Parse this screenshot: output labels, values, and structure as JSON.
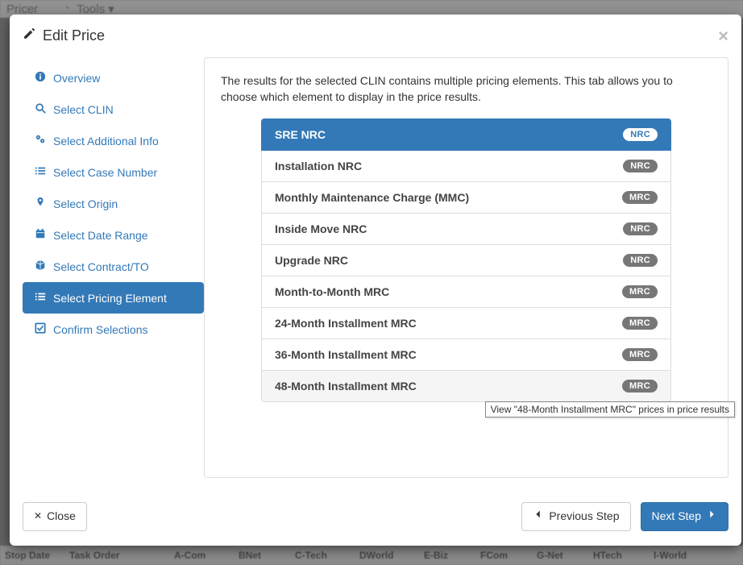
{
  "background": {
    "top_items": [
      "Pricer",
      "Tools"
    ],
    "table_headers": [
      "Stop Date",
      "Task Order",
      "A-Com",
      "BNet",
      "C-Tech",
      "DWorld",
      "E-Biz",
      "FCom",
      "G-Net",
      "HTech",
      "I-World"
    ]
  },
  "modal": {
    "title": "Edit Price",
    "close_aria": "Close"
  },
  "wizard": {
    "items": [
      {
        "icon": "info",
        "label": "Overview"
      },
      {
        "icon": "search",
        "label": "Select CLIN"
      },
      {
        "icon": "cogs",
        "label": "Select Additional Info"
      },
      {
        "icon": "list",
        "label": "Select Case Number"
      },
      {
        "icon": "pin",
        "label": "Select Origin"
      },
      {
        "icon": "calendar",
        "label": "Select Date Range"
      },
      {
        "icon": "cube",
        "label": "Select Contract/TO"
      },
      {
        "icon": "list",
        "label": "Select Pricing Element"
      },
      {
        "icon": "check",
        "label": "Confirm Selections"
      }
    ],
    "active_index": 7
  },
  "panel": {
    "intro": "The results for the selected CLIN contains multiple pricing elements. This tab allows you to choose which element to display in the price results.",
    "elements": [
      {
        "label": "SRE NRC",
        "badge": "NRC",
        "active": true
      },
      {
        "label": "Installation NRC",
        "badge": "NRC"
      },
      {
        "label": "Monthly Maintenance Charge (MMC)",
        "badge": "MRC"
      },
      {
        "label": "Inside Move NRC",
        "badge": "NRC"
      },
      {
        "label": "Upgrade NRC",
        "badge": "NRC"
      },
      {
        "label": "Month-to-Month MRC",
        "badge": "MRC"
      },
      {
        "label": "24-Month Installment MRC",
        "badge": "MRC"
      },
      {
        "label": "36-Month Installment MRC",
        "badge": "MRC"
      },
      {
        "label": "48-Month Installment MRC",
        "badge": "MRC",
        "hovered": true
      }
    ],
    "tooltip": "View \"48-Month Installment MRC\" prices in price results"
  },
  "footer": {
    "close_label": "Close",
    "prev_label": "Previous Step",
    "next_label": "Next Step"
  }
}
